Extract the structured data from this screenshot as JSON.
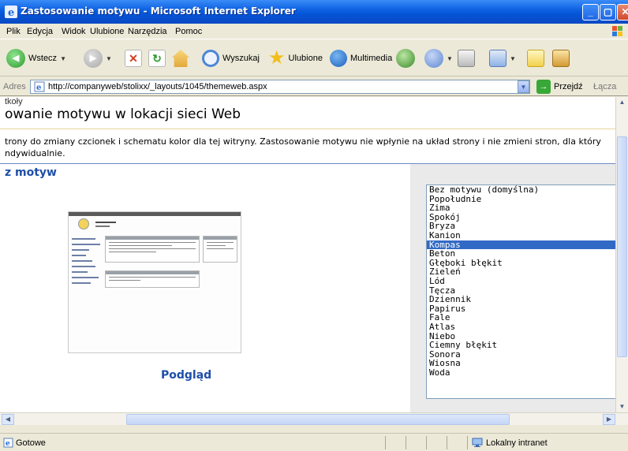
{
  "window": {
    "title": "Zastosowanie motywu - Microsoft Internet Explorer",
    "minimize": "_",
    "maximize": "▢",
    "close": "✕"
  },
  "menu": [
    "Plik",
    "Edycja",
    "Widok",
    "Ulubione",
    "Narzędzia",
    "Pomoc"
  ],
  "toolbar": {
    "back": "Wstecz",
    "search": "Wyszukaj",
    "favorites": "Ulubione",
    "media": "Multimedia"
  },
  "address": {
    "label": "Adres",
    "url": "http://companyweb/stolixx/_layouts/1045/themeweb.aspx",
    "go": "Przejdź",
    "links": "Łącza"
  },
  "page": {
    "breadcrumb": "tkoły",
    "heading": "owanie motywu w lokacji sieci Web",
    "description": "trony do zmiany czcionek i schematu kolor dla tej witryny. Zastosowanie motywu nie wpłynie na układ strony i nie zmieni stron, dla który ndywidualnie.",
    "section_title": "z motyw",
    "preview_label": "Podgląd"
  },
  "themes": {
    "selected": "Kompas",
    "options": [
      "Bez motywu (domyślna)",
      "Popołudnie",
      "Zima",
      "Spokój",
      "Bryza",
      "Kanion",
      "Kompas",
      "Beton",
      "Głęboki błękit",
      "Zieleń",
      "Lód",
      "Tęcza",
      "Dziennik",
      "Papirus",
      "Fale",
      "Atlas",
      "Niebo",
      "Ciemny błękit",
      "Sonora",
      "Wiosna",
      "Woda"
    ]
  },
  "status": {
    "text": "Gotowe",
    "zone": "Lokalny intranet"
  },
  "colors": {
    "titlebar": "#0a5ee0",
    "selection": "#316ac5",
    "section_title": "#1e4fa8"
  }
}
